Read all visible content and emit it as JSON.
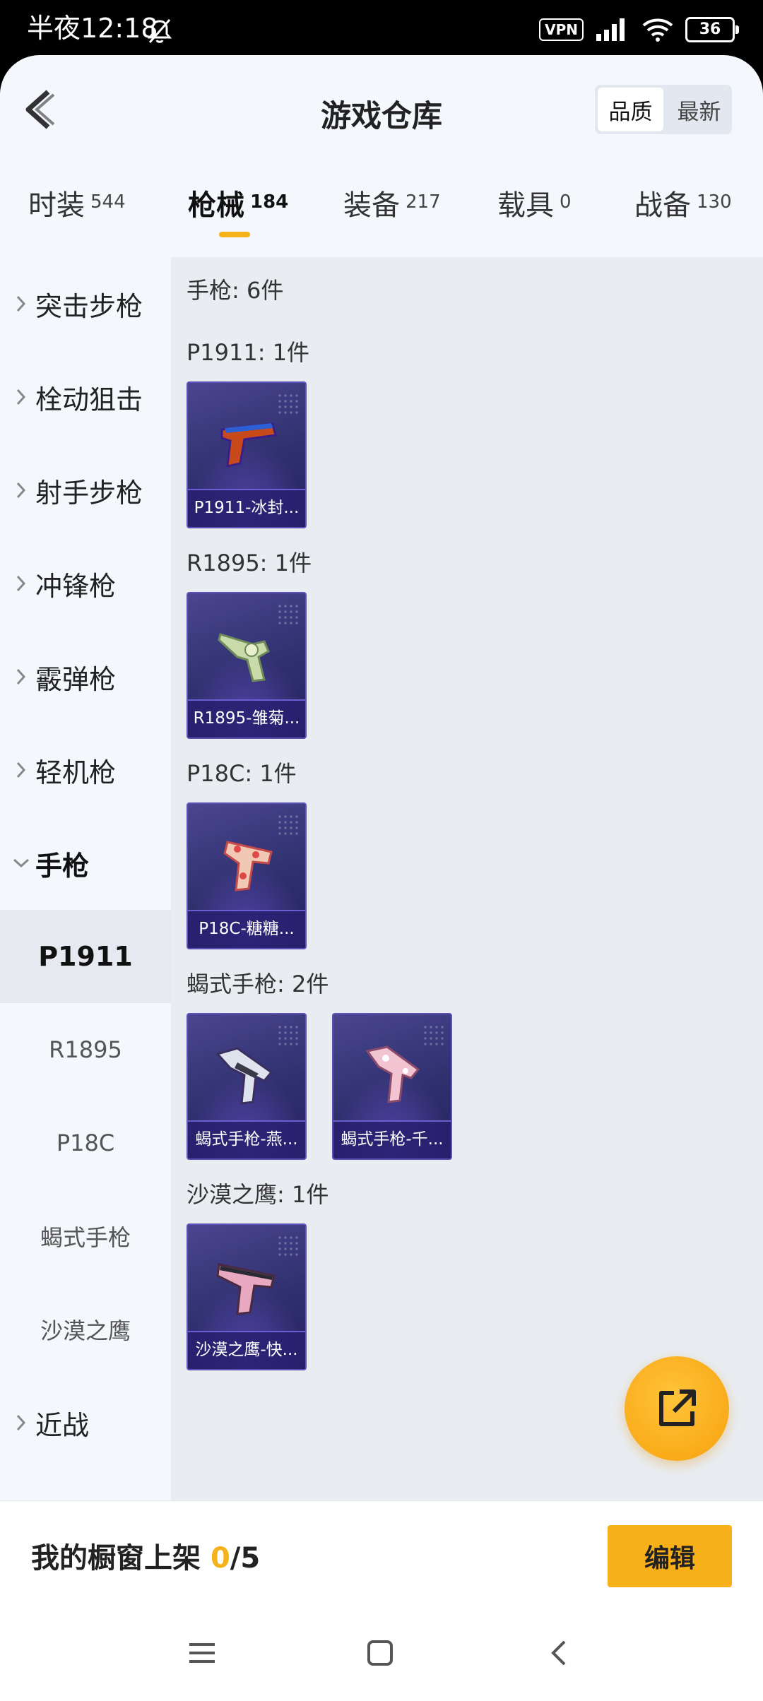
{
  "status_bar": {
    "time": "半夜12:18",
    "vpn": "VPN",
    "battery": "36"
  },
  "header": {
    "title": "游戏仓库",
    "sort_options": [
      "品质",
      "最新"
    ]
  },
  "tabs": [
    {
      "label": "时装",
      "count": "544"
    },
    {
      "label": "枪械",
      "count": "184"
    },
    {
      "label": "装备",
      "count": "217"
    },
    {
      "label": "载具",
      "count": "0"
    },
    {
      "label": "战备",
      "count": "130"
    }
  ],
  "sidebar": {
    "categories": [
      "突击步枪",
      "栓动狙击",
      "射手步枪",
      "冲锋枪",
      "霰弹枪",
      "轻机枪"
    ],
    "open_category": "手枪",
    "subs": [
      "P1911",
      "R1895",
      "P18C",
      "蝎式手枪",
      "沙漠之鹰"
    ],
    "last_category": "近战"
  },
  "content": {
    "summary": "手枪: 6件",
    "sections": [
      {
        "title": "P1911: 1件",
        "items": [
          "P1911-冰封..."
        ]
      },
      {
        "title": "R1895: 1件",
        "items": [
          "R1895-雏菊..."
        ]
      },
      {
        "title": "P18C: 1件",
        "items": [
          "P18C-糖糖..."
        ]
      },
      {
        "title": "蝎式手枪: 2件",
        "items": [
          "蝎式手枪-燕...",
          "蝎式手枪-千..."
        ]
      },
      {
        "title": "沙漠之鹰: 1件",
        "items": [
          "沙漠之鹰-快..."
        ]
      }
    ]
  },
  "bottom": {
    "shelf_label": "我的橱窗上架",
    "shelf_count": "0",
    "shelf_total": "/5",
    "edit_label": "编辑"
  },
  "colors": {
    "accent": "#f5b21a",
    "card_bg": "#30306f"
  }
}
